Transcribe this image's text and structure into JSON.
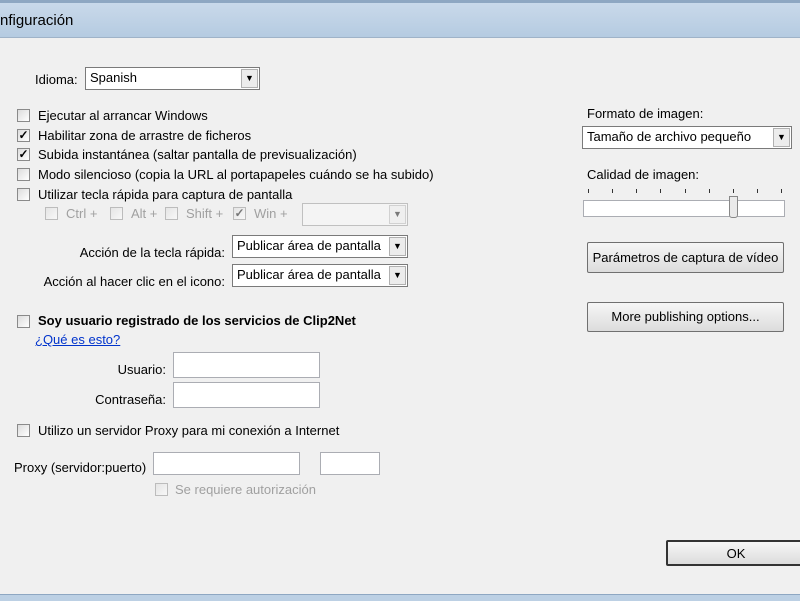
{
  "window": {
    "title": "nfiguración"
  },
  "language": {
    "label": "Idioma:",
    "value": "Spanish"
  },
  "options": [
    {
      "label": "Ejecutar al arrancar Windows",
      "checked": false
    },
    {
      "label": "Habilitar zona de arrastre de ficheros",
      "checked": true
    },
    {
      "label": "Subida instantánea (saltar pantalla de previsualización)",
      "checked": true
    },
    {
      "label": "Modo silencioso (copia la URL al portapapeles cuándo se ha subido)",
      "checked": false
    },
    {
      "label": "Utilizar tecla rápida para captura de pantalla",
      "checked": false
    }
  ],
  "modifiers": [
    {
      "label": "Ctrl +",
      "checked": false
    },
    {
      "label": "Alt +",
      "checked": false
    },
    {
      "label": "Shift +",
      "checked": false
    },
    {
      "label": "Win +",
      "checked": true
    }
  ],
  "hotkey_key": "",
  "hotkey_action": {
    "label": "Acción de la tecla rápida:",
    "value": "Publicar área de pantalla"
  },
  "icon_action": {
    "label": "Acción al hacer clic en el icono:",
    "value": "Publicar área de pantalla"
  },
  "registered": {
    "label": "Soy usuario registrado de los servicios de Clip2Net",
    "checked": false,
    "link": "¿Qué es esto?"
  },
  "user": {
    "label": "Usuario:",
    "value": ""
  },
  "password": {
    "label": "Contraseña:",
    "value": ""
  },
  "proxy": {
    "checkbox_label": "Utilizo un servidor Proxy para mi conexión a Internet",
    "checked": false,
    "label": "Proxy (servidor:puerto)",
    "server": "",
    "port": "",
    "auth_label": "Se requiere autorización",
    "auth_checked": false
  },
  "image_format": {
    "label": "Formato de imagen:",
    "value": "Tamaño de archivo pequeño"
  },
  "image_quality": {
    "label": "Calidad de imagen:",
    "ticks": 9,
    "value_fraction": 0.75
  },
  "buttons": {
    "video": "Parámetros de captura de vídeo",
    "publishing": "More publishing options...",
    "ok": "OK"
  }
}
